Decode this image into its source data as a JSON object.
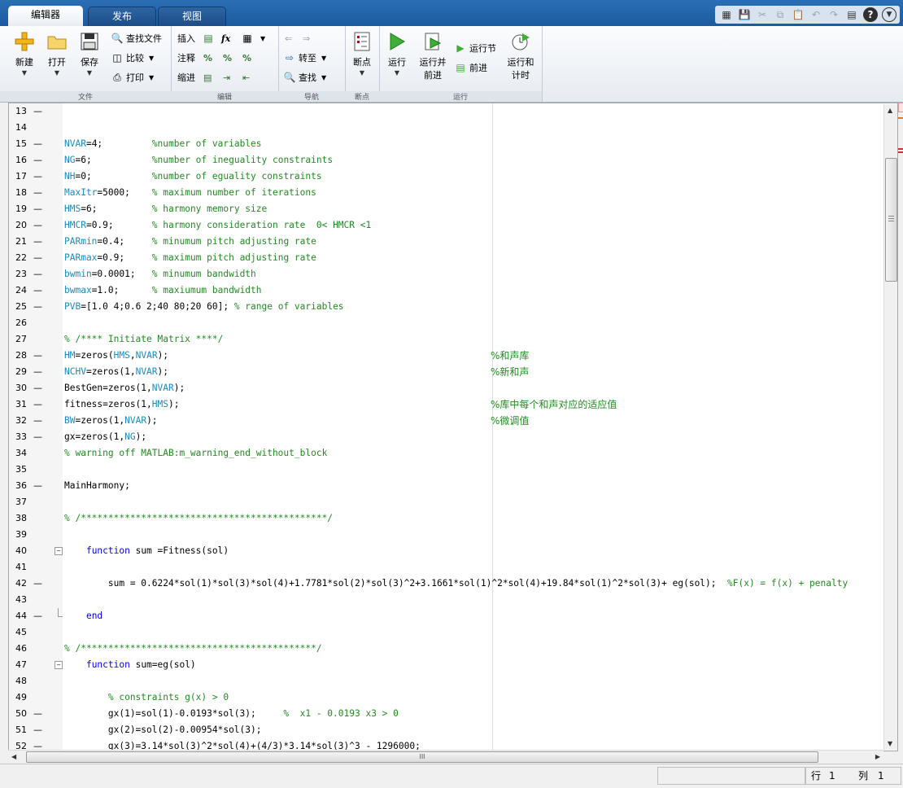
{
  "tabs": [
    {
      "label": "编辑器",
      "active": true
    },
    {
      "label": "发布",
      "active": false
    },
    {
      "label": "视图",
      "active": false
    }
  ],
  "quick_access": [
    "figure-icon",
    "save-icon",
    "cut-icon",
    "copy-icon",
    "paste-icon",
    "undo-icon",
    "redo-icon",
    "switch-window-icon",
    "help-icon",
    "menu-icon"
  ],
  "ribbon": {
    "file": {
      "label": "文件",
      "new": "新建",
      "open": "打开",
      "save": "保存",
      "find_files": "查找文件",
      "compare": "比较",
      "print": "打印"
    },
    "edit": {
      "label": "编辑",
      "insert": "插入",
      "comment": "注释",
      "indent": "缩进",
      "fx": "fx"
    },
    "navigate": {
      "label": "导航",
      "goto": "转至",
      "find": "查找"
    },
    "breakpoints": {
      "label": "断点",
      "breakpoints": "断点"
    },
    "run": {
      "label": "运行",
      "run": "运行",
      "run_advance_1": "运行并",
      "run_advance_2": "前进",
      "run_section": "运行节",
      "advance": "前进",
      "run_time_1": "运行和",
      "run_time_2": "计时"
    }
  },
  "code_lines": [
    {
      "n": "13",
      "bp": true,
      "text": ""
    },
    {
      "n": "14",
      "bp": false,
      "text": ""
    },
    {
      "n": "15",
      "bp": true,
      "var": "NVAR",
      "rest": "=4;",
      "comment": "%number of variables"
    },
    {
      "n": "16",
      "bp": true,
      "var": "NG",
      "rest": "=6;",
      "comment": "%number of ineguality constraints"
    },
    {
      "n": "17",
      "bp": true,
      "var": "NH",
      "rest": "=0;",
      "comment": "%number of eguality constraints"
    },
    {
      "n": "18",
      "bp": true,
      "var": "MaxItr",
      "rest": "=5000;",
      "comment": "% maximum number of iterations"
    },
    {
      "n": "19",
      "bp": true,
      "var": "HMS",
      "rest": "=6;",
      "comment": "% harmony memory size"
    },
    {
      "n": "20",
      "bp": true,
      "var": "HMCR",
      "rest": "=0.9;",
      "comment": "% harmony consideration rate  0< HMCR <1"
    },
    {
      "n": "21",
      "bp": true,
      "var": "PARmin",
      "rest": "=0.4;",
      "comment": "% minumum pitch adjusting rate"
    },
    {
      "n": "22",
      "bp": true,
      "var": "PARmax",
      "rest": "=0.9;",
      "comment": "% maximum pitch adjusting rate"
    },
    {
      "n": "23",
      "bp": true,
      "var": "bwmin",
      "rest": "=0.0001;",
      "comment": "% minumum bandwidth"
    },
    {
      "n": "24",
      "bp": true,
      "var": "bwmax",
      "rest": "=1.0;",
      "comment": "% maxiumum bandwidth"
    },
    {
      "n": "25",
      "bp": true,
      "var": "PVB",
      "rest": "=[1.0 4;0.6 2;40 80;20 60];",
      "comment": "% range of variables"
    },
    {
      "n": "26",
      "bp": false,
      "text": ""
    },
    {
      "n": "27",
      "bp": false,
      "full_comment": "% /**** Initiate Matrix ****/"
    },
    {
      "n": "28",
      "bp": true,
      "code": "HM=zeros(HMS,NVAR);",
      "cn": "%和声库"
    },
    {
      "n": "29",
      "bp": true,
      "code": "NCHV=zeros(1,NVAR);",
      "cn": "%新和声"
    },
    {
      "n": "30",
      "bp": true,
      "code": "BestGen=zeros(1,NVAR);"
    },
    {
      "n": "31",
      "bp": true,
      "code": "fitness=zeros(1,HMS);",
      "cn": "%库中每个和声对应的适应值"
    },
    {
      "n": "32",
      "bp": true,
      "code": "BW=zeros(1,NVAR);",
      "cn": "%微调值"
    },
    {
      "n": "33",
      "bp": true,
      "code": "gx=zeros(1,NG);"
    },
    {
      "n": "34",
      "bp": false,
      "full_comment": "% warning off MATLAB:m_warning_end_without_block"
    },
    {
      "n": "35",
      "bp": false,
      "text": ""
    },
    {
      "n": "36",
      "bp": true,
      "code": "MainHarmony;"
    },
    {
      "n": "37",
      "bp": false,
      "text": ""
    },
    {
      "n": "38",
      "bp": false,
      "full_comment": "% /*********************************************/"
    },
    {
      "n": "39",
      "bp": false,
      "text": ""
    },
    {
      "n": "40",
      "bp": false,
      "fold": "open",
      "kw": "    function",
      "after": " sum =Fitness(sol)"
    },
    {
      "n": "41",
      "bp": false,
      "text": ""
    },
    {
      "n": "42",
      "bp": true,
      "code": "        sum = 0.6224*sol(1)*sol(3)*sol(4)+1.7781*sol(2)*sol(3)^2+3.1661*sol(1)^2*sol(4)+19.84*sol(1)^2*sol(3)+ eg(sol);",
      "tail_comment": "  %F(x) = f(x) + penalty"
    },
    {
      "n": "43",
      "bp": false,
      "text": ""
    },
    {
      "n": "44",
      "bp": true,
      "fold": "end",
      "kw": "    end",
      "after": ""
    },
    {
      "n": "45",
      "bp": false,
      "text": ""
    },
    {
      "n": "46",
      "bp": false,
      "full_comment": "% /*******************************************/"
    },
    {
      "n": "47",
      "bp": false,
      "fold": "open",
      "kw": "    function",
      "after": " sum=eg(sol)"
    },
    {
      "n": "48",
      "bp": false,
      "text": ""
    },
    {
      "n": "49",
      "bp": false,
      "indent_comment": "        % constraints g(x) > 0"
    },
    {
      "n": "50",
      "bp": true,
      "code": "        gx(1)=sol(1)-0.0193*sol(3);",
      "tail_comment": "     %  x1 - 0.0193 x3 > 0"
    },
    {
      "n": "51",
      "bp": true,
      "code": "        gx(2)=sol(2)-0.00954*sol(3);"
    },
    {
      "n": "52",
      "bp": true,
      "code": "        gx(3)=3.14*sol(3)^2*sol(4)+(4/3)*3.14*sol(3)^3 - 1296000;"
    }
  ],
  "status": {
    "row_label": "行",
    "row_value": "1",
    "col_label": "列",
    "col_value": "1"
  },
  "hscroll_grip": "III"
}
